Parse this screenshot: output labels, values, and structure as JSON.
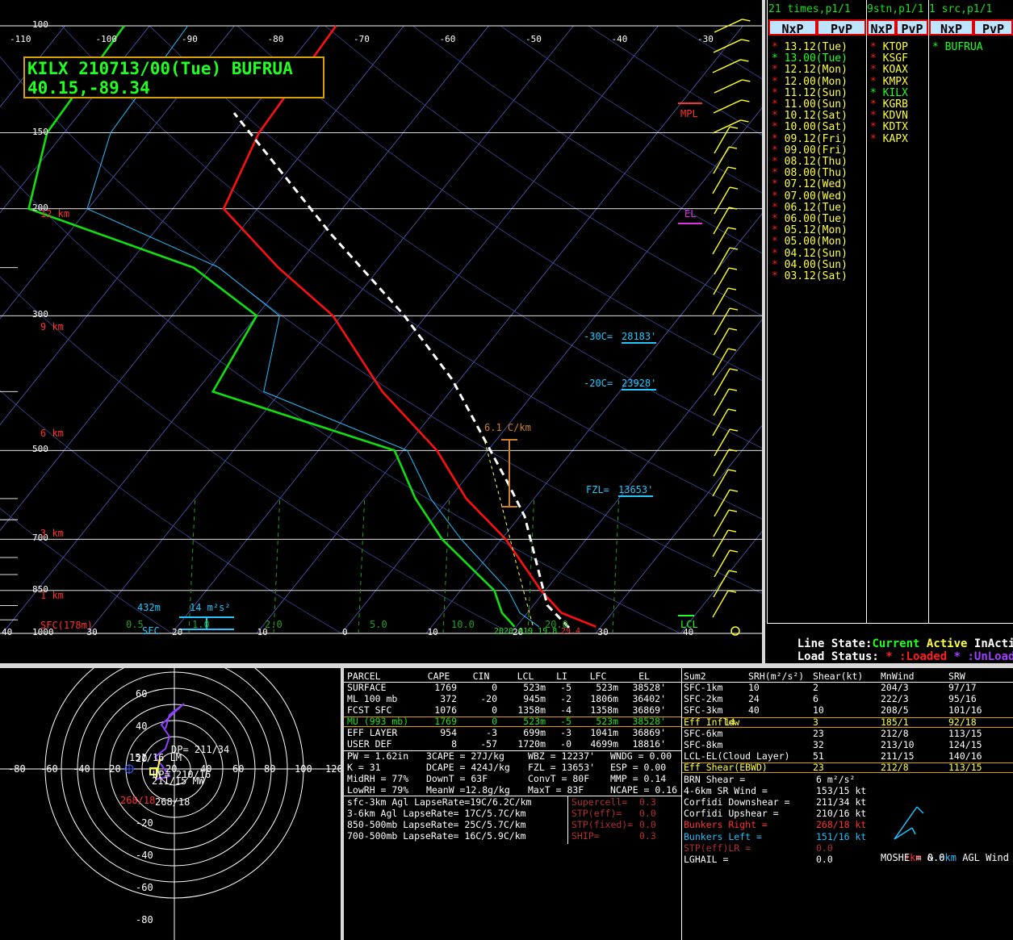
{
  "skewt": {
    "title": "KILX 210713/00(Tue) BUFRUA",
    "latlon": "40.15,-89.34",
    "pressure_labels": [
      {
        "text": "100",
        "p": 100
      },
      {
        "text": "150",
        "p": 150
      },
      {
        "text": "200",
        "p": 200
      },
      {
        "text": "300",
        "p": 300
      },
      {
        "text": "500",
        "p": 500
      },
      {
        "text": "700",
        "p": 700
      },
      {
        "text": "850",
        "p": 850
      },
      {
        "text": "1000",
        "p": 1000
      }
    ],
    "height_labels": [
      {
        "text": "12 km",
        "kind": "km"
      },
      {
        "text": "9 km",
        "kind": "km"
      },
      {
        "text": "6 km",
        "kind": "km"
      },
      {
        "text": "3 km",
        "kind": "km"
      },
      {
        "text": "1 km",
        "kind": "km"
      },
      {
        "text": "SFC(178m)",
        "kind": "sfc"
      }
    ],
    "top_temp_labels": [
      "-110",
      "-100",
      "-90",
      "-80",
      "-70",
      "-60",
      "-50",
      "-40",
      "-30"
    ],
    "bottom_temp_labels": [
      "40",
      "30",
      "20",
      "10",
      "0",
      "10",
      "20",
      "30",
      "40"
    ],
    "mixing_ratio_labels": [
      "0.5",
      "1.0",
      "2.0",
      "5.0",
      "10.0",
      "20.0"
    ],
    "annotations": {
      "mpl": "MPL",
      "el": "EL",
      "lcl": "LCL",
      "minus30": "-30C=",
      "minus30_val": "28183'",
      "minus20": "-20C=",
      "minus20_val": "23928'",
      "fzl": "FZL=",
      "fzl_val": "13653'",
      "lapse": "6.1 C/km",
      "eff_depth": "432m",
      "eff_srh": "14 m²s²",
      "sfc": "SFC",
      "sfc_temps": "2020.019 19.8",
      "sfc_red": "29.4"
    },
    "colors": {
      "temp": "#ff1010",
      "dewp": "#10e010",
      "wetbulb": "#20c0ff",
      "parcel": "#ffffff",
      "isobar": "#ffffff",
      "isotherm": "#5060c0",
      "mixratio": "#20a020",
      "barb": "#ffff20"
    }
  },
  "chart_data": {
    "type": "line",
    "title": "KILX 210713/00(Tue) BUFRUA",
    "xlabel": "",
    "ylabel": "",
    "series": [
      {
        "name": "",
        "values_p_t": [
          [
            975,
            29.4
          ],
          [
            925,
            24
          ],
          [
            850,
            19.5
          ],
          [
            700,
            10.5
          ],
          [
            600,
            2
          ],
          [
            500,
            -6
          ],
          [
            400,
            -18
          ],
          [
            300,
            -31
          ],
          [
            250,
            -42
          ],
          [
            200,
            -54
          ],
          [
            150,
            -57
          ],
          [
            100,
            -58
          ]
        ]
      },
      {
        "name": "",
        "values_p_t": [
          [
            975,
            19.8
          ],
          [
            925,
            17
          ],
          [
            850,
            14
          ],
          [
            700,
            3
          ],
          [
            600,
            -4
          ],
          [
            500,
            -11
          ],
          [
            400,
            -38
          ],
          [
            300,
            -40
          ],
          [
            250,
            -52
          ],
          [
            200,
            -77
          ],
          [
            150,
            -82
          ],
          [
            100,
            -83
          ]
        ]
      }
    ]
  },
  "lists": {
    "times_title": "21 times,p1/1",
    "stn_title": "9stn,p1/1",
    "src_title": "1 src,p1/1",
    "nxp": "NxP",
    "pvp": "PvP",
    "times": [
      {
        "star": "*",
        "label": "13.12(Tue)",
        "star_color": "#ff2020",
        "label_color": "#ffff40"
      },
      {
        "star": "*",
        "label": "13.00(Tue)",
        "star_color": "#20ff20",
        "label_color": "#20ff20"
      },
      {
        "star": "*",
        "label": "12.12(Mon)",
        "star_color": "#ff2020",
        "label_color": "#ffff40"
      },
      {
        "star": "*",
        "label": "12.00(Mon)",
        "star_color": "#ff2020",
        "label_color": "#ffff40"
      },
      {
        "star": "*",
        "label": "11.12(Sun)",
        "star_color": "#ff2020",
        "label_color": "#ffff40"
      },
      {
        "star": "*",
        "label": "11.00(Sun)",
        "star_color": "#ff2020",
        "label_color": "#ffff40"
      },
      {
        "star": "*",
        "label": "10.12(Sat)",
        "star_color": "#ff2020",
        "label_color": "#ffff40"
      },
      {
        "star": "*",
        "label": "10.00(Sat)",
        "star_color": "#ff2020",
        "label_color": "#ffff40"
      },
      {
        "star": "*",
        "label": "09.12(Fri)",
        "star_color": "#ff2020",
        "label_color": "#ffff40"
      },
      {
        "star": "*",
        "label": "09.00(Fri)",
        "star_color": "#ff2020",
        "label_color": "#ffff40"
      },
      {
        "star": "*",
        "label": "08.12(Thu)",
        "star_color": "#ff2020",
        "label_color": "#ffff40"
      },
      {
        "star": "*",
        "label": "08.00(Thu)",
        "star_color": "#ff2020",
        "label_color": "#ffff40"
      },
      {
        "star": "*",
        "label": "07.12(Wed)",
        "star_color": "#ff2020",
        "label_color": "#ffff40"
      },
      {
        "star": "*",
        "label": "07.00(Wed)",
        "star_color": "#ff2020",
        "label_color": "#ffff40"
      },
      {
        "star": "*",
        "label": "06.12(Tue)",
        "star_color": "#ff2020",
        "label_color": "#ffff40"
      },
      {
        "star": "*",
        "label": "06.00(Tue)",
        "star_color": "#ff2020",
        "label_color": "#ffff40"
      },
      {
        "star": "*",
        "label": "05.12(Mon)",
        "star_color": "#ff2020",
        "label_color": "#ffff40"
      },
      {
        "star": "*",
        "label": "05.00(Mon)",
        "star_color": "#ff2020",
        "label_color": "#ffff40"
      },
      {
        "star": "*",
        "label": "04.12(Sun)",
        "star_color": "#ff2020",
        "label_color": "#ffff40"
      },
      {
        "star": "*",
        "label": "04.00(Sun)",
        "star_color": "#ff2020",
        "label_color": "#ffff40"
      },
      {
        "star": "*",
        "label": "03.12(Sat)",
        "star_color": "#ff2020",
        "label_color": "#ffff40"
      }
    ],
    "stations": [
      {
        "star": "*",
        "label": "KTOP",
        "star_color": "#ff2020",
        "label_color": "#ffff40"
      },
      {
        "star": "*",
        "label": "KSGF",
        "star_color": "#ff2020",
        "label_color": "#ffff40"
      },
      {
        "star": "*",
        "label": "KOAX",
        "star_color": "#ff2020",
        "label_color": "#ffff40"
      },
      {
        "star": "*",
        "label": "KMPX",
        "star_color": "#ff2020",
        "label_color": "#ffff40"
      },
      {
        "star": "*",
        "label": "KILX",
        "star_color": "#20ff20",
        "label_color": "#20ff20"
      },
      {
        "star": "*",
        "label": "KGRB",
        "star_color": "#ff2020",
        "label_color": "#ffff40"
      },
      {
        "star": "*",
        "label": "KDVN",
        "star_color": "#ff2020",
        "label_color": "#ffff40"
      },
      {
        "star": "*",
        "label": "KDTX",
        "star_color": "#ff2020",
        "label_color": "#ffff40"
      },
      {
        "star": "*",
        "label": "KAPX",
        "star_color": "#ff2020",
        "label_color": "#ffff40"
      }
    ],
    "sources": [
      {
        "star": "*",
        "label": "BUFRUA",
        "star_color": "#20ff20",
        "label_color": "#20ff20"
      }
    ],
    "line_state_label": "Line State:",
    "current": "Current",
    "active": "Active",
    "inactive": "InActive",
    "load_status_label": "Load Status:",
    "loaded": "* :Loaded",
    "unloaded": "* :UnLoaded"
  },
  "hodograph": {
    "x_labels": [
      "-80",
      "-60",
      "-40",
      "-20",
      "20",
      "40",
      "60",
      "80",
      "100",
      "120"
    ],
    "y_labels": [
      "60",
      "40",
      "20",
      "-20",
      "-40",
      "-60",
      "-80"
    ],
    "labels": {
      "dp1": "DP= 211/34",
      "up": "UP= 210/16",
      "mw": "211/15 MW",
      "lm": "151/16 LM",
      "rm": "268/18",
      "rm2": "268/18"
    }
  },
  "parcel_table": {
    "headers": [
      "PARCEL",
      "CAPE",
      "CIN",
      "LCL",
      "LI",
      "LFC",
      "EL"
    ],
    "rows": [
      {
        "cells": [
          "SURFACE",
          "1769",
          "0",
          "523m",
          "-5",
          "523m",
          "38528'"
        ],
        "color": "#ffffff",
        "highlight": false
      },
      {
        "cells": [
          "ML 100 mb",
          "372",
          "-20",
          "945m",
          "-2",
          "1806m",
          "36402'"
        ],
        "color": "#ffffff",
        "highlight": false
      },
      {
        "cells": [
          "FCST SFC",
          "1076",
          "0",
          "1358m",
          "-4",
          "1358m",
          "36869'"
        ],
        "color": "#ffffff",
        "highlight": false
      },
      {
        "cells": [
          "MU (993 mb)",
          "1769",
          "0",
          "523m",
          "-5",
          "523m",
          "38528'"
        ],
        "color": "#20e020",
        "highlight": true
      },
      {
        "cells": [
          "EFF LAYER",
          "954",
          "-3",
          "699m",
          "-3",
          "1041m",
          "36869'"
        ],
        "color": "#ffffff",
        "highlight": false
      },
      {
        "cells": [
          "USER DEF",
          "8",
          "-57",
          "1720m",
          "-0",
          "4699m",
          "18816'"
        ],
        "color": "#ffffff",
        "highlight": false
      }
    ],
    "misc": [
      [
        "PW = 1.62in",
        "3CAPE = 27J/kg",
        "WBZ = 12237'",
        "WNDG = 0.00"
      ],
      [
        "K = 31",
        "DCAPE = 424J/kg",
        "FZL = 13653'",
        "ESP = 0.00"
      ],
      [
        "MidRH = 77%",
        "DownT = 63F",
        "ConvT = 80F",
        "MMP = 0.14"
      ],
      [
        "LowRH = 79%",
        "MeanW =12.8g/kg",
        "MaxT = 83F",
        "NCAPE = 0.16"
      ]
    ],
    "lapse": [
      "sfc-3km Agl LapseRate=19C/6.2C/km",
      "3-6km Agl LapseRate= 17C/5.7C/km",
      "850-500mb LapseRate= 25C/5.7C/km",
      "700-500mb LapseRate= 16C/5.9C/km"
    ],
    "composites": [
      {
        "label": "Supercell=",
        "value": "0.3"
      },
      {
        "label": "STP(eff)=",
        "value": "0.0"
      },
      {
        "label": "STP(fixed)=",
        "value": "0.0"
      },
      {
        "label": "SHIP=",
        "value": "0.3"
      }
    ]
  },
  "kinematics": {
    "headers": [
      "Sum2",
      "SRH(m²/s²)",
      "Shear(kt)",
      "MnWind",
      "SRW"
    ],
    "rows": [
      {
        "cells": [
          "SFC-1km",
          "10",
          "2",
          "204/3",
          "97/17"
        ],
        "color": "#ffffff",
        "boxed": false
      },
      {
        "cells": [
          "SFC-2km",
          "24",
          "6",
          "222/3",
          "95/16"
        ],
        "color": "#ffffff",
        "boxed": false
      },
      {
        "cells": [
          "SFC-3km",
          "40",
          "10",
          "208/5",
          "101/16"
        ],
        "color": "#ffffff",
        "boxed": false
      },
      {
        "cells": [
          "Eff Inflow",
          "14",
          "3",
          "185/1",
          "92/18"
        ],
        "color": "#ffff40",
        "boxed": true
      },
      {
        "cells": [
          "SFC-6km",
          "",
          "23",
          "212/8",
          "113/15"
        ],
        "color": "#ffffff",
        "boxed": false
      },
      {
        "cells": [
          "SFC-8km",
          "",
          "32",
          "213/10",
          "124/15"
        ],
        "color": "#ffffff",
        "boxed": false
      },
      {
        "cells": [
          "LCL-EL(Cloud Layer)",
          "",
          "51",
          "211/15",
          "140/16"
        ],
        "color": "#ffffff",
        "boxed": false
      },
      {
        "cells": [
          "Eff Shear(EBWD)",
          "",
          "23",
          "212/8",
          "113/15"
        ],
        "color": "#ffff40",
        "boxed": true
      }
    ],
    "extra": [
      {
        "label": "BRN Shear =",
        "value": "6 m²/s²",
        "color": "#ffffff"
      },
      {
        "label": "4-6km SR Wind =",
        "value": "153/15 kt",
        "color": "#ffffff"
      },
      {
        "label": "Corfidi Downshear =",
        "value": "211/34 kt",
        "color": "#ffffff"
      },
      {
        "label": "Corfidi Upshear =",
        "value": "210/16 kt",
        "color": "#ffffff"
      },
      {
        "label": "Bunkers Right =",
        "value": "268/18 kt",
        "color": "#ff3030"
      },
      {
        "label": "Bunkers Left =",
        "value": "151/16 kt",
        "color": "#20c0ff"
      },
      {
        "label": "STP(eff)LR =",
        "value": "0.0",
        "color": "#b03030"
      },
      {
        "label": "LGHAIL =",
        "value": "0.0",
        "color": "#ffffff"
      }
    ],
    "barb_caption_1km": "1km",
    "barb_caption_and": " & ",
    "barb_caption_6km": "6km",
    "barb_caption_rest": " AGL Wind Barb",
    "moshe": "MOSHE = 0.0"
  }
}
